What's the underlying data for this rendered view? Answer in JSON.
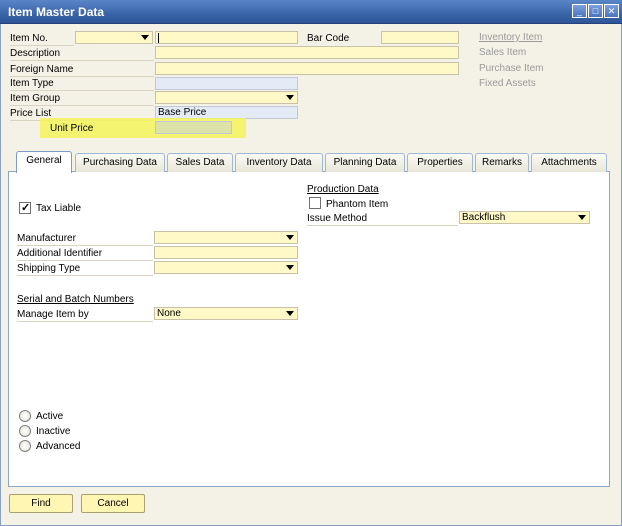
{
  "window": {
    "title": "Item Master Data"
  },
  "header": {
    "item_no_label": "Item No.",
    "bar_code_label": "Bar Code",
    "description_label": "Description",
    "foreign_name_label": "Foreign Name",
    "item_type_label": "Item Type",
    "item_group_label": "Item Group",
    "price_list_label": "Price List",
    "price_list_value": "Base Price",
    "unit_price_label": "Unit Price",
    "flags": [
      "Inventory Item",
      "Sales Item",
      "Purchase Item",
      "Fixed Assets"
    ]
  },
  "tabs": [
    "General",
    "Purchasing Data",
    "Sales Data",
    "Inventory Data",
    "Planning Data",
    "Properties",
    "Remarks",
    "Attachments"
  ],
  "general": {
    "tax_liable_label": "Tax Liable",
    "tax_liable_checked": true,
    "production_data_label": "Production Data",
    "phantom_item_label": "Phantom Item",
    "issue_method_label": "Issue Method",
    "issue_method_value": "Backflush",
    "manufacturer_label": "Manufacturer",
    "additional_identifier_label": "Additional Identifier",
    "shipping_type_label": "Shipping Type",
    "serial_batch_label": "Serial and Batch Numbers",
    "manage_item_by_label": "Manage Item by",
    "manage_item_by_value": "None",
    "status_options": [
      "Active",
      "Inactive",
      "Advanced"
    ]
  },
  "footer": {
    "find_label": "Find",
    "cancel_label": "Cancel"
  },
  "colors": {
    "field_bg": "#fff9c8",
    "highlight": "#f3f55a",
    "title_bar": "#3a64a8"
  }
}
